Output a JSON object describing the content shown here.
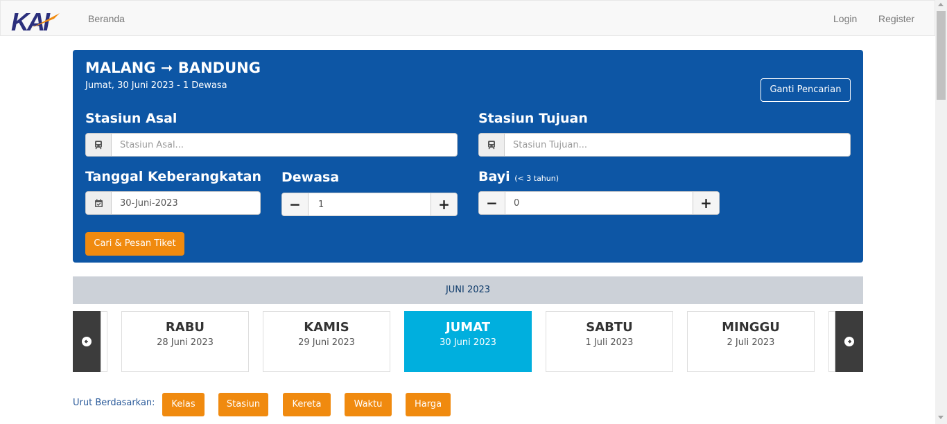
{
  "brand": {
    "logo_text": "KAI"
  },
  "nav": {
    "home": "Beranda",
    "login": "Login",
    "register": "Register"
  },
  "search": {
    "origin_city": "MALANG",
    "arrow": "➞",
    "destination_city": "BANDUNG",
    "summary": "Jumat, 30 Juni 2023 - 1 Dewasa",
    "change_button": "Ganti Pencarian",
    "origin_label": "Stasiun Asal",
    "origin_placeholder": "Stasiun Asal...",
    "destination_label": "Stasiun Tujuan",
    "destination_placeholder": "Stasiun Tujuan...",
    "date_label": "Tanggal Keberangkatan",
    "date_value": "30-Juni-2023",
    "adult_label": "Dewasa",
    "adult_value": "1",
    "infant_label": "Bayi",
    "infant_note": "(< 3 tahun)",
    "infant_value": "0",
    "minus": "−",
    "plus": "+",
    "submit_button": "Cari & Pesan Tiket"
  },
  "calendar": {
    "month": "JUNI 2023",
    "days": [
      {
        "name": "RABU",
        "date": "28 Juni 2023"
      },
      {
        "name": "KAMIS",
        "date": "29 Juni 2023"
      },
      {
        "name": "JUMAT",
        "date": "30 Juni 2023"
      },
      {
        "name": "SABTU",
        "date": "1 Juli 2023"
      },
      {
        "name": "MINGGU",
        "date": "2 Juli 2023"
      }
    ],
    "active_index": 2
  },
  "sort": {
    "label": "Urut Berdasarkan:",
    "options": [
      "Kelas",
      "Stasiun",
      "Kereta",
      "Waktu",
      "Harga"
    ]
  },
  "colors": {
    "panel": "#0d56a5",
    "accent_orange": "#f08a0f",
    "active_day": "#00afde",
    "month_bar": "#ccd1d8"
  },
  "icons": {
    "train": "train-icon",
    "calendar": "calendar-icon",
    "prev": "arrow-left-circle-icon",
    "next": "arrow-right-circle-icon"
  }
}
